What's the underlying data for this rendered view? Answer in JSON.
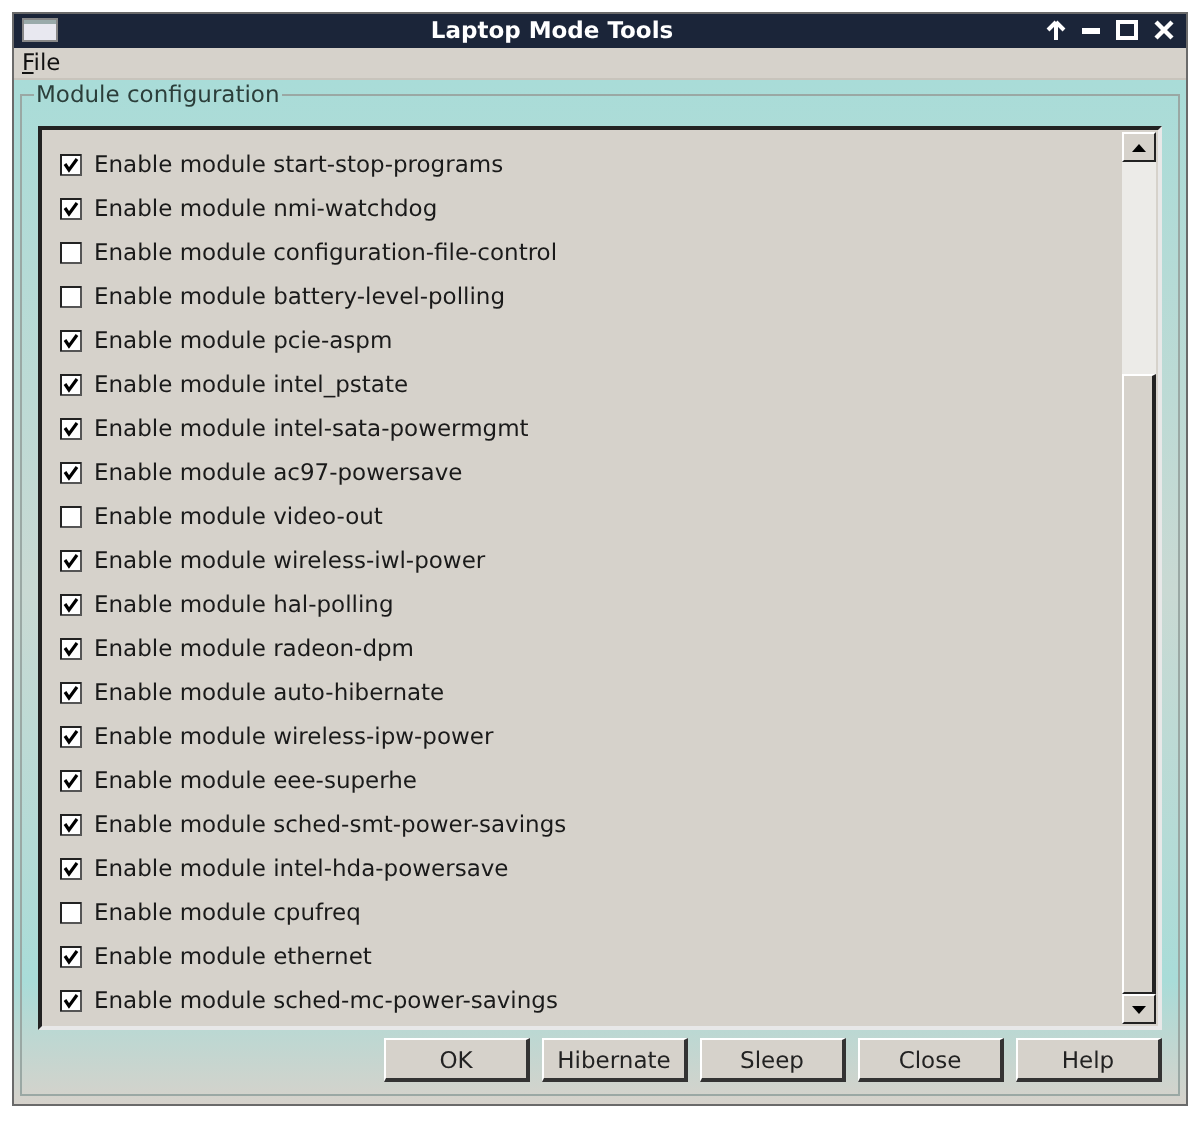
{
  "window": {
    "title": "Laptop Mode Tools"
  },
  "menu": [
    {
      "label": "File"
    }
  ],
  "group": {
    "title": "Module configuration"
  },
  "modules": [
    {
      "label": "Enable module start-stop-programs",
      "checked": true
    },
    {
      "label": "Enable module nmi-watchdog",
      "checked": true
    },
    {
      "label": "Enable module configuration-file-control",
      "checked": false
    },
    {
      "label": "Enable module battery-level-polling",
      "checked": false
    },
    {
      "label": "Enable module pcie-aspm",
      "checked": true
    },
    {
      "label": "Enable module intel_pstate",
      "checked": true
    },
    {
      "label": "Enable module intel-sata-powermgmt",
      "checked": true
    },
    {
      "label": "Enable module ac97-powersave",
      "checked": true
    },
    {
      "label": "Enable module video-out",
      "checked": false
    },
    {
      "label": "Enable module wireless-iwl-power",
      "checked": true
    },
    {
      "label": "Enable module hal-polling",
      "checked": true
    },
    {
      "label": "Enable module radeon-dpm",
      "checked": true
    },
    {
      "label": "Enable module auto-hibernate",
      "checked": true
    },
    {
      "label": "Enable module wireless-ipw-power",
      "checked": true
    },
    {
      "label": "Enable module eee-superhe",
      "checked": true
    },
    {
      "label": "Enable module sched-smt-power-savings",
      "checked": true
    },
    {
      "label": "Enable module intel-hda-powersave",
      "checked": true
    },
    {
      "label": "Enable module cpufreq",
      "checked": false
    },
    {
      "label": "Enable module ethernet",
      "checked": true
    },
    {
      "label": "Enable module sched-mc-power-savings",
      "checked": true
    }
  ],
  "buttons": [
    "OK",
    "Hibernate",
    "Sleep",
    "Close",
    "Help"
  ]
}
